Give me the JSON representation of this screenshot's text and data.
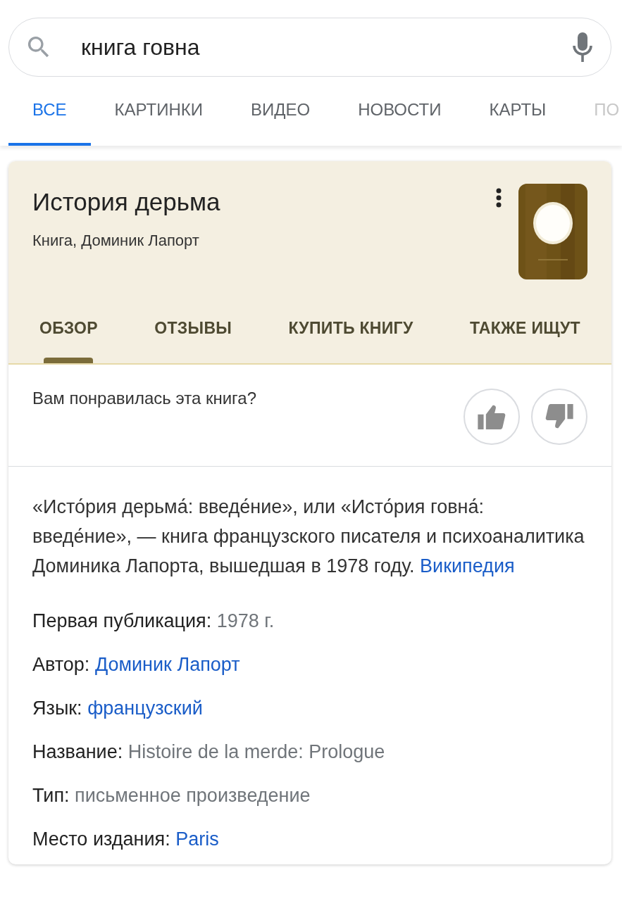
{
  "search": {
    "value": "книга говна"
  },
  "tabs": [
    {
      "label": "ВСЕ",
      "selected": true
    },
    {
      "label": "КАРТИНКИ",
      "selected": false
    },
    {
      "label": "ВИДЕО",
      "selected": false
    },
    {
      "label": "НОВОСТИ",
      "selected": false
    },
    {
      "label": "КАРТЫ",
      "selected": false
    },
    {
      "label": "ПО",
      "selected": false
    }
  ],
  "card": {
    "title": "История дерьма",
    "subtitle": "Книга, Доминик Лапорт",
    "tabs": [
      {
        "label": "ОБЗОР",
        "selected": true
      },
      {
        "label": "ОТЗЫВЫ",
        "selected": false
      },
      {
        "label": "КУПИТЬ КНИГУ",
        "selected": false
      },
      {
        "label": "ТАКЖЕ ИЩУТ",
        "selected": false
      }
    ],
    "question": "Вам понравилась эта книга?",
    "description": "«Исто́рия дерьма́: введе́ние», или «Исто́рия говна́: введе́ние», — книга французского писателя и психоаналитика Доминика Лапорта, вышедшая в 1978 году.",
    "source": "Википедия",
    "facts": [
      {
        "label": "Первая публикация:",
        "value": "1978 г.",
        "kind": "text"
      },
      {
        "label": "Автор:",
        "value": "Доминик Лапорт",
        "kind": "link"
      },
      {
        "label": "Язык:",
        "value": "французский",
        "kind": "link"
      },
      {
        "label": "Название:",
        "value": "Histoire de la merde: Prologue",
        "kind": "text"
      },
      {
        "label": "Тип:",
        "value": "письменное произведение",
        "kind": "text"
      },
      {
        "label": "Место издания:",
        "value": "Paris",
        "kind": "link"
      }
    ]
  }
}
